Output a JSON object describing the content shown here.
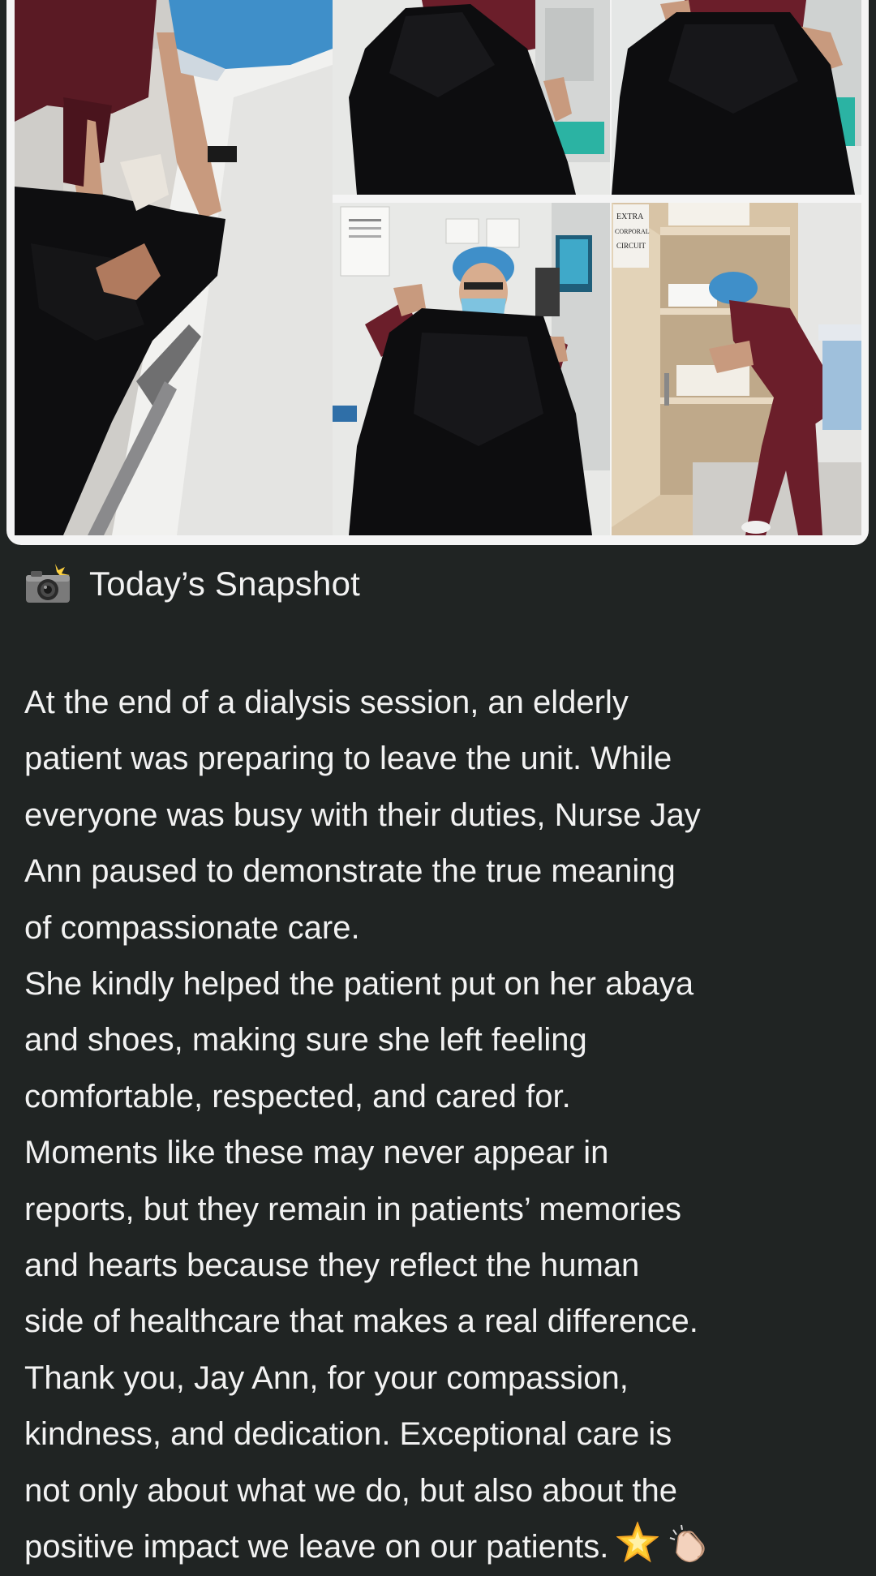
{
  "post": {
    "header": {
      "icon": "camera-with-flash-icon",
      "title": "Today’s Snapshot"
    },
    "body_lines": [
      "At the end of a dialysis session, an elderly",
      "patient was preparing to leave the unit. While",
      "everyone was busy with their duties, Nurse Jay",
      "Ann paused to demonstrate the true meaning",
      "of compassionate care.",
      "She kindly helped the patient put on her abaya",
      "and shoes, making sure she left feeling",
      "comfortable, respected, and cared for.",
      "Moments like these may never appear in",
      "reports, but they remain in patients’ memories",
      "and hearts because they reflect the human",
      "side of healthcare that makes a real difference.",
      "Thank you, Jay Ann, for your compassion,",
      "kindness, and dedication. Exceptional care is",
      "not only about what we do, but also about the",
      "positive impact we leave on our patients."
    ],
    "trailing_emojis": [
      "glowing-star-icon",
      "clapping-hands-icon"
    ]
  },
  "collage": {
    "photos": [
      {
        "subject": "nurse-helping-patient-with-shoes"
      },
      {
        "subject": "nurse-holding-black-abaya"
      },
      {
        "subject": "nurse-draping-black-abaya"
      },
      {
        "subject": "nurse-with-face-mask-holding-abaya"
      },
      {
        "subject": "nurse-at-supply-cabinet"
      }
    ],
    "sign_text": [
      "EXTRA",
      "CORPORAL",
      "CIRCUIT"
    ]
  },
  "colors": {
    "background": "#202423",
    "text": "#f2f2f2",
    "scrub": "#6b1e2a",
    "cap": "#3f8fc9",
    "abaya": "#0d0d0f",
    "collage_border": "#f4f4f4"
  }
}
